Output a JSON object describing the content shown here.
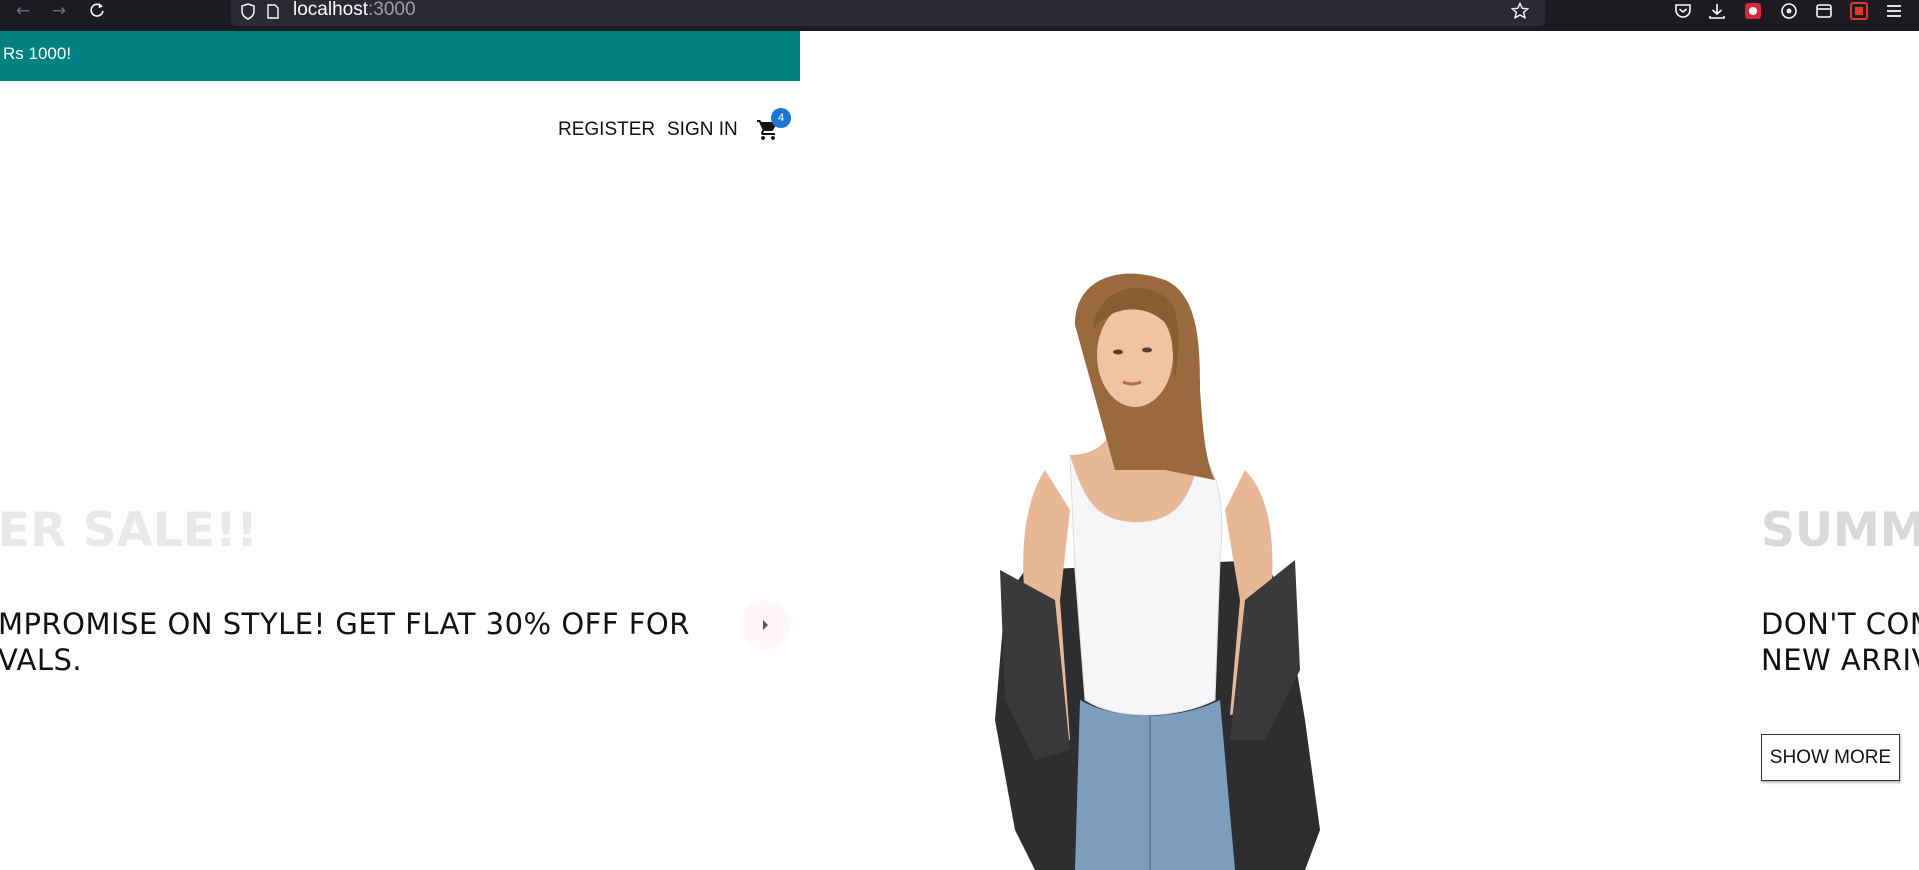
{
  "browser": {
    "url_host": "localhost",
    "url_port": ":3000"
  },
  "announcement": {
    "text": "Rs 1000!",
    "color": "#008080"
  },
  "nav": {
    "register": "REGISTER",
    "sign_in": "SIGN IN",
    "cart_count": "4",
    "badge_color": "#1976d2"
  },
  "slides": {
    "left": {
      "title": "ER SALE!!",
      "desc_line1": "MPROMISE ON STYLE! GET FLAT 30% OFF FOR",
      "desc_line2": "VALS."
    },
    "right": {
      "title": "SUMM",
      "desc_line1": "DON'T COM",
      "desc_line2": "NEW ARRIV",
      "button": "SHOW MORE"
    }
  },
  "icons": {
    "back": "arrow-left-icon",
    "forward": "arrow-right-icon",
    "reload": "reload-icon",
    "cart": "shopping-cart-icon",
    "next": "chevron-right-icon"
  }
}
